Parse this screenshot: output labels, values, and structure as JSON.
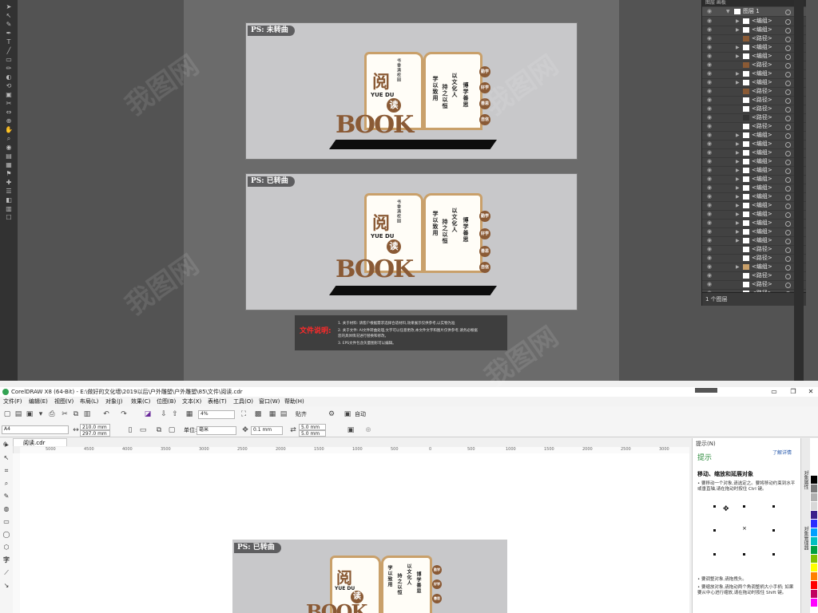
{
  "illustrator": {
    "tools": [
      "➤",
      "↖",
      "✎",
      "✒",
      "T",
      "╱",
      "▭",
      "✏",
      "◐",
      "⟲",
      "▣",
      "✂",
      "⇔",
      "⊕",
      "✋",
      "⌕",
      "◉",
      "▤",
      "▦",
      "⚑",
      "✚",
      "☰",
      "◧",
      "▥",
      "☐"
    ],
    "panel1": {
      "tag": "PS: 未转曲"
    },
    "panel2": {
      "tag": "PS: 已转曲"
    },
    "artwork": {
      "title": "阅",
      "title2": "读",
      "pinyin": "YUE DU",
      "tagline": "书香满校园",
      "book_word": "BOOK",
      "vertical_texts": [
        "学以致用",
        "持之以恒",
        "以文化人",
        "博学善思"
      ],
      "circles": [
        "勤学",
        "好学",
        "善思",
        "自信"
      ]
    },
    "notes": {
      "label": "文件说明:",
      "lines": [
        "1. 关于材料: 请客户根据需求选择合适材料,效果展示仅供参考,以实物为准",
        "2. 关于文件: AI文件转曲处理,文字可以任意更改,本文件文字和图片仅供参考,请务必根据",
        "   您的具体情况进行替换和修改。",
        "3. EPS文件包含矢量图形可以编辑。"
      ]
    },
    "layers": {
      "tabs": "图层   画板",
      "top_layer": "图层 1",
      "items": [
        "<编组>",
        "<编组>",
        "<路径>",
        "<编组>",
        "<编组>",
        "<路径>",
        "<编组>",
        "<编组>",
        "<路径>",
        "<路径>",
        "<路径>",
        "<路径>",
        "<路径>",
        "<编组>",
        "<编组>",
        "<编组>",
        "<编组>",
        "<编组>",
        "<编组>",
        "<编组>",
        "<编组>",
        "<编组>",
        "<编组>",
        "<编组>",
        "<编组>",
        "<编组>",
        "<路径>",
        "<路径>",
        "<编组>",
        "<路径>",
        "<路径>",
        "<路径>"
      ],
      "footer": "1 个图层"
    }
  },
  "coreldraw": {
    "title": "CorelDRAW X8 (64-Bit) - E:\\做好的文化墙\\2019以后\\户外雕塑\\户外雕塑\\85\\文件\\阅读.cdr",
    "menu": [
      "文件(F)",
      "编辑(E)",
      "视图(V)",
      "布局(L)",
      "对象(J)",
      "效果(C)",
      "位图(B)",
      "文本(X)",
      "表格(T)",
      "工具(O)",
      "窗口(W)",
      "帮助(H)"
    ],
    "zoom": "4%",
    "snap": "贴齐",
    "auto": "自动",
    "page_size": "A4",
    "width": "210.0 mm",
    "height": "297.0 mm",
    "unit_label": "单位:",
    "unit": "毫米",
    "nudge": "0.1 mm",
    "dup_x": "5.0 mm",
    "dup_y": "5.0 mm",
    "doc_tab": "阅读.cdr",
    "ruler_ticks": [
      "5000",
      "4500",
      "4000",
      "3500",
      "3000",
      "2500",
      "2000",
      "1500",
      "1000",
      "500",
      "0",
      "500",
      "1000",
      "1500",
      "2000",
      "2500",
      "3000"
    ],
    "canvas_tag": "PS: 已转曲",
    "hints": {
      "header": "提示(N)",
      "title": "提示",
      "link": "了解详情",
      "heading": "移动、缩放和延展对象",
      "p1": "• 要移动一个对象,请选定之。要将移动约束到水平或垂直轴,请在拖动时按住 Ctrl 键。",
      "p2": "• 要调整对象,请拖拽头。",
      "p3": "• 要缩放对象,请拖动两个角调整柄大小手柄; 如果要从中心进行缩放,请在拖动时按住 Shift 键。"
    },
    "dock_labels": [
      "对象属性",
      "对象管理器"
    ],
    "palette": [
      "#ffffff",
      "#000000",
      "#7a7a7a",
      "#b0b0b0",
      "#d8d8d8",
      "#3b1f8c",
      "#2a2aff",
      "#00a0ff",
      "#00c0c0",
      "#00a040",
      "#80c000",
      "#ffff00",
      "#ff8000",
      "#ff0000",
      "#c00060",
      "#ff00ff"
    ]
  },
  "watermark": "我图网"
}
